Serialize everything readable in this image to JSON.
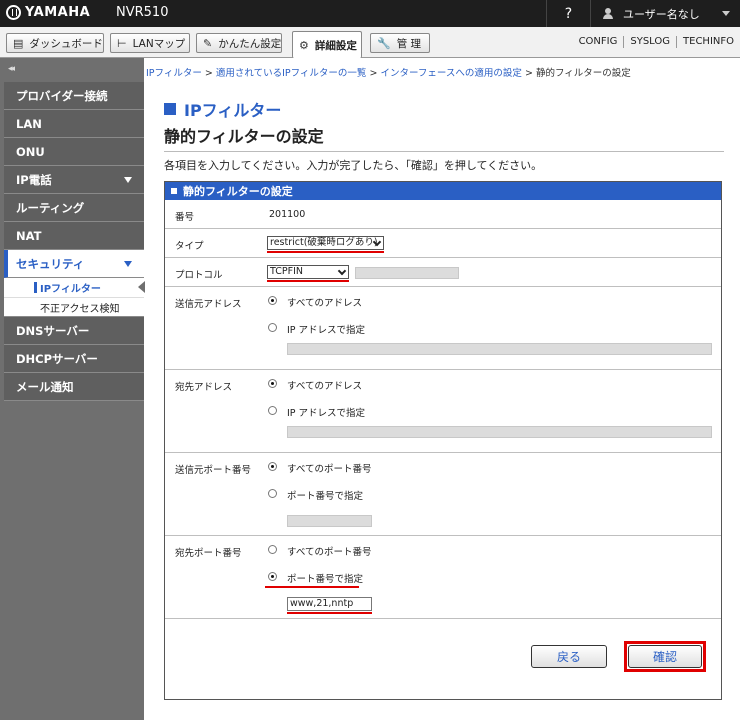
{
  "header": {
    "brand": "YAMAHA",
    "model": "NVR510",
    "help": "?",
    "user": "ユーザー名なし"
  },
  "tabs": [
    {
      "label": "ダッシュボード",
      "icon": "dashboard-icon"
    },
    {
      "label": "LANマップ",
      "icon": "lan-map-icon"
    },
    {
      "label": "かんたん設定",
      "icon": "wand-icon"
    },
    {
      "label": "詳細設定",
      "icon": "gear-icon",
      "active": true
    },
    {
      "label": "管 理",
      "icon": "wrench-icon"
    }
  ],
  "toplinks": [
    "CONFIG",
    "SYSLOG",
    "TECHINFO"
  ],
  "sidebar": {
    "collapse": "◂◂",
    "items": [
      {
        "label": "プロバイダー接続"
      },
      {
        "label": "LAN"
      },
      {
        "label": "ONU"
      },
      {
        "label": "IP電話"
      },
      {
        "label": "ルーティング"
      },
      {
        "label": "NAT"
      },
      {
        "label": "セキュリティ"
      },
      {
        "label": "DNSサーバー"
      },
      {
        "label": "DHCPサーバー"
      },
      {
        "label": "メール通知"
      }
    ],
    "sub_items": [
      {
        "label": "IPフィルター"
      },
      {
        "label": "不正アクセス検知"
      }
    ]
  },
  "breadcrumb": {
    "links": [
      "IPフィルター",
      "適用されているIPフィルターの一覧",
      "インターフェースへの適用の設定"
    ],
    "separator": ">",
    "current": "静的フィルターの設定"
  },
  "page": {
    "kicker": "IPフィルター",
    "title": "静的フィルターの設定",
    "instructions": "各項目を入力してください。入力が完了したら、「確認」を押してください。"
  },
  "form": {
    "header": "静的フィルターの設定",
    "number_label": "番号",
    "number_value": "201100",
    "type_label": "タイプ",
    "type_value": "restrict(破棄時ログあり)",
    "protocol_label": "プロトコル",
    "protocol_value": "TCPFIN",
    "src_addr_label": "送信元アドレス",
    "dst_addr_label": "宛先アドレス",
    "all_addresses": "すべてのアドレス",
    "specify_ip": "IP アドレスで指定",
    "src_port_label": "送信元ポート番号",
    "dst_port_label": "宛先ポート番号",
    "all_ports": "すべてのポート番号",
    "specify_port": "ポート番号で指定",
    "dst_port_value": "www,21,nntp"
  },
  "buttons": {
    "back": "戻る",
    "confirm": "確認"
  },
  "colors": {
    "accent": "#2a5fc4",
    "highlight": "#e00000",
    "sidebar": "#6f6f6f"
  }
}
